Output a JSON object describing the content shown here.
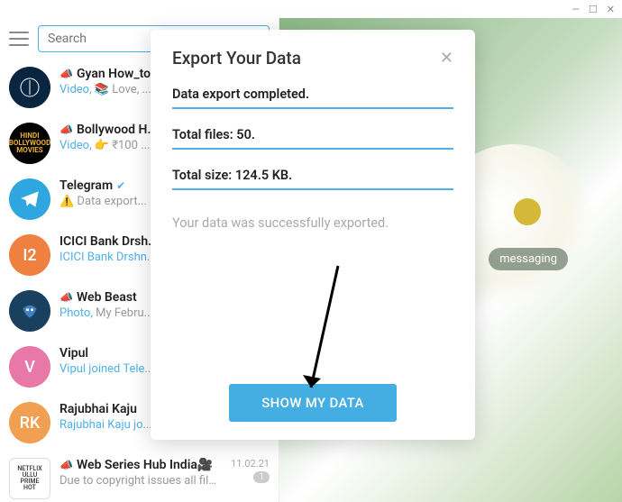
{
  "titlebar": {
    "min": "—",
    "max": "☐",
    "close": "✕"
  },
  "search": {
    "placeholder": "Search"
  },
  "chats": [
    {
      "icon": "megaphone",
      "title": "Gyan How_to",
      "prefix": "Video,",
      "preview": " 📚 Love, ..."
    },
    {
      "icon": "megaphone",
      "title": "Bollywood H...",
      "prefix": "Video,",
      "preview": " 👉 ₹100 ..."
    },
    {
      "icon": "",
      "title": "Telegram",
      "verified": true,
      "prefix": "",
      "preview": "⚠️ Data export..."
    },
    {
      "icon": "",
      "title": "ICICI Bank Drsh...",
      "prefix": "ICICI Bank Drshn...",
      "preview": ""
    },
    {
      "icon": "megaphone",
      "title": "Web Beast",
      "prefix": "Photo,",
      "preview": " My Febru..."
    },
    {
      "icon": "",
      "title": "Vipul",
      "prefix": "Vipul joined Tele...",
      "preview": ""
    },
    {
      "icon": "",
      "title": "Rajubhai Kaju",
      "prefix": "Rajubhai Kaju jo...",
      "preview": ""
    },
    {
      "icon": "megaphone",
      "title": "Web Series Hub India🎥",
      "date": "11.02.21",
      "badge": "1",
      "prefix": "",
      "preview": "Due to copyright issues all files ar..."
    }
  ],
  "main": {
    "status": "messaging"
  },
  "modal": {
    "title": "Export Your Data",
    "line1": "Data export completed.",
    "line2": "Total files: 50.",
    "line3": "Total size: 124.5 KB.",
    "success": "Your data was successfully exported.",
    "button": "SHOW MY DATA"
  }
}
